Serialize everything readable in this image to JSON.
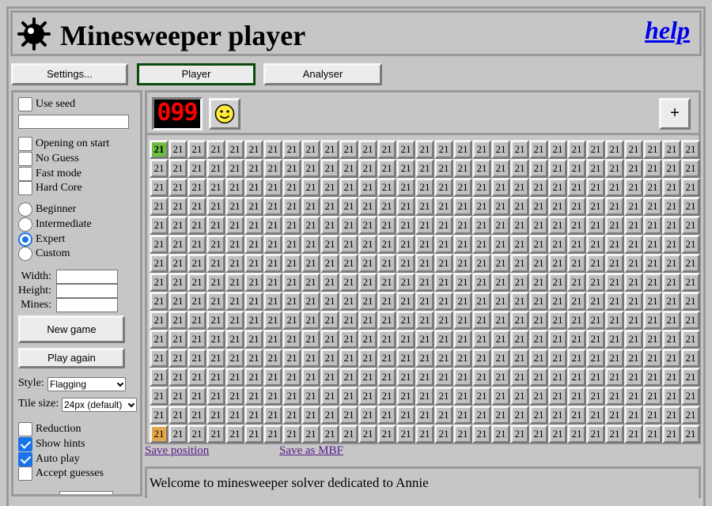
{
  "header": {
    "title": "Minesweeper player",
    "help_label": "help"
  },
  "tabs": [
    {
      "label": "Settings..."
    },
    {
      "label": "Player"
    },
    {
      "label": "Analyser"
    }
  ],
  "sidebar": {
    "use_seed_label": "Use seed",
    "seed_value": "",
    "options": [
      {
        "label": "Opening on start",
        "checked": false
      },
      {
        "label": "No Guess",
        "checked": false
      },
      {
        "label": "Fast mode",
        "checked": false
      },
      {
        "label": "Hard Core",
        "checked": false
      }
    ],
    "difficulty": [
      {
        "label": "Beginner",
        "selected": false
      },
      {
        "label": "Intermediate",
        "selected": false
      },
      {
        "label": "Expert",
        "selected": true
      },
      {
        "label": "Custom",
        "selected": false
      }
    ],
    "width_label": "Width:",
    "height_label": "Height:",
    "mines_label": "Mines:",
    "new_game_label": "New game",
    "play_again_label": "Play again",
    "style_label": "Style:",
    "style_value": "Flagging",
    "tile_size_label": "Tile size:",
    "tile_size_value": "24px (default)",
    "assist": [
      {
        "label": "Reduction",
        "checked": false
      },
      {
        "label": "Show hints",
        "checked": true
      },
      {
        "label": "Auto play",
        "checked": true
      },
      {
        "label": "Accept guesses",
        "checked": false
      }
    ]
  },
  "game": {
    "mine_counter": "099",
    "zoom_label": "+",
    "tile_text": "21",
    "rows": 16,
    "cols": 29,
    "hint_safe_index": 0,
    "hint_guess_index": 435
  },
  "links": {
    "save_position": "Save position",
    "save_mbf": "Save as MBF"
  },
  "message": "Welcome to minesweeper solver dedicated to Annie",
  "colors": {
    "safe_hint": "#6fbe44",
    "guess_hint": "#e2a84a",
    "counter_digits": "#ff0000",
    "active_tab_border": "#0b4a0b",
    "link": "#551a8b",
    "help": "#0000ee"
  }
}
